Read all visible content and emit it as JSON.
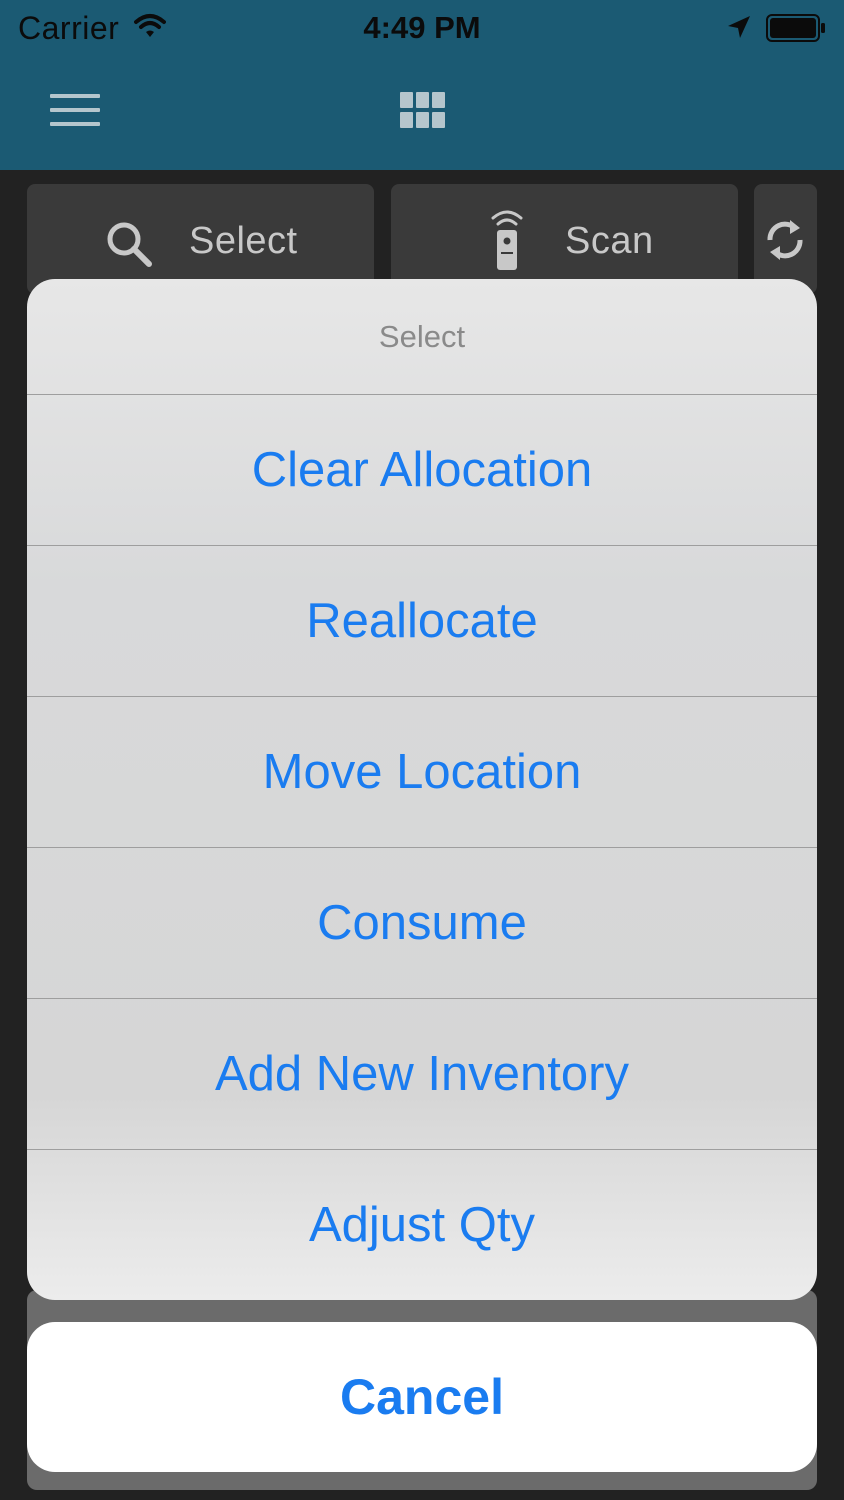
{
  "status_bar": {
    "carrier": "Carrier",
    "time": "4:49 PM"
  },
  "nav": {
    "menu_icon": "hamburger-menu-icon",
    "grid_icon": "grid-icon",
    "bar_color": "#1b5a73"
  },
  "toolbar": {
    "select_label": "Select",
    "scan_label": "Scan",
    "sync_icon": "sync-icon"
  },
  "action_sheet": {
    "title": "Select",
    "items": [
      {
        "label": "Clear Allocation"
      },
      {
        "label": "Reallocate"
      },
      {
        "label": "Move Location"
      },
      {
        "label": "Consume"
      },
      {
        "label": "Add New Inventory"
      },
      {
        "label": "Adjust Qty"
      }
    ],
    "cancel_label": "Cancel",
    "accent_color": "#1a7cf0"
  }
}
